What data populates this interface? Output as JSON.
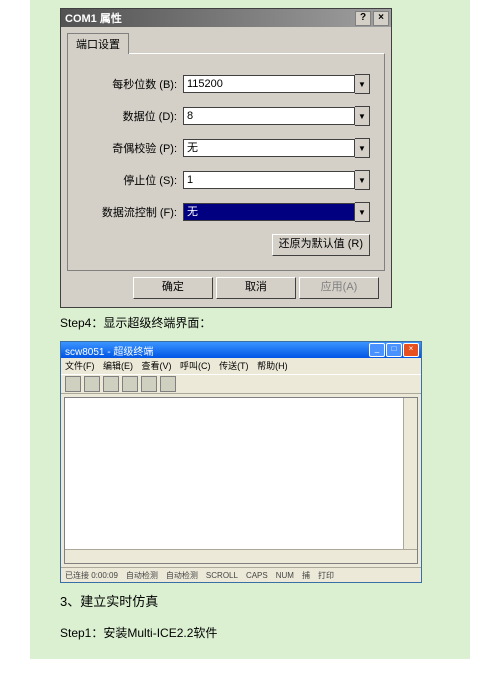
{
  "dialog": {
    "title": "COM1 属性",
    "help": "?",
    "close": "×",
    "tab": "端口设置",
    "fields": {
      "baud_label": "每秒位数 (B):",
      "baud_value": "115200",
      "data_label": "数据位 (D):",
      "data_value": "8",
      "parity_label": "奇偶校验 (P):",
      "parity_value": "无",
      "stop_label": "停止位 (S):",
      "stop_value": "1",
      "flow_label": "数据流控制 (F):",
      "flow_value": "无"
    },
    "restore": "还原为默认值 (R)",
    "ok": "确定",
    "cancel": "取消",
    "apply": "应用(A)"
  },
  "captions": {
    "step4": "Step4：显示超级终端界面：",
    "section3": "3、建立实时仿真",
    "step1": "Step1：安装Multi-ICE2.2软件"
  },
  "hyperterm": {
    "title": "scw8051 - 超级终端",
    "menu": [
      "文件(F)",
      "编辑(E)",
      "查看(V)",
      "呼叫(C)",
      "传送(T)",
      "帮助(H)"
    ],
    "status": [
      "已连接 0:00:09",
      "自动检测",
      "自动检测",
      "SCROLL",
      "CAPS",
      "NUM",
      "捕",
      "打印"
    ]
  }
}
